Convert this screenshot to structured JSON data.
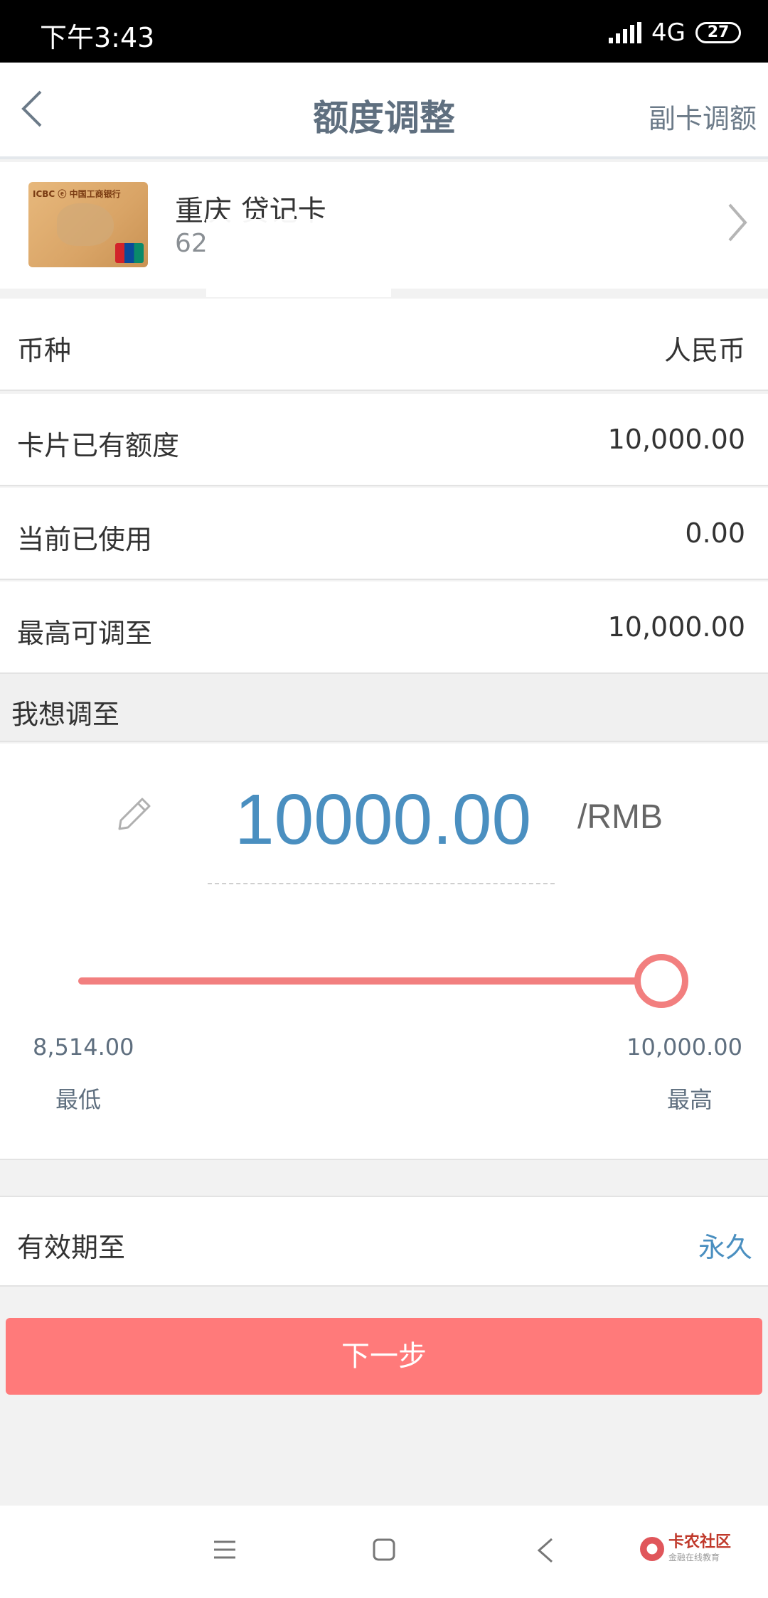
{
  "status_bar": {
    "time": "下午3:43",
    "network": "4G",
    "battery": "27"
  },
  "nav": {
    "title": "额度调整",
    "right_action": "副卡调额"
  },
  "card": {
    "name": "重庆 贷记卡",
    "number": "62"
  },
  "rows": {
    "currency": {
      "label": "币种",
      "value": "人民币"
    },
    "existing_limit": {
      "label": "卡片已有额度",
      "value": "10,000.00"
    },
    "used": {
      "label": "当前已使用",
      "value": "0.00"
    },
    "max_adjust": {
      "label": "最高可调至",
      "value": "10,000.00"
    }
  },
  "adjust": {
    "header": "我想调至",
    "amount": "10000.00",
    "unit": "/RMB",
    "slider_fraction": 1.0,
    "min_value": "8,514.00",
    "min_label": "最低",
    "max_value": "10,000.00",
    "max_label": "最高"
  },
  "validity": {
    "label": "有效期至",
    "value": "永久"
  },
  "actions": {
    "next": "下一步"
  },
  "watermark": {
    "name": "卡农社区",
    "sub": "金融在线教育"
  },
  "colors": {
    "accent_blue": "#4a8fc0",
    "accent_red": "#ff7a7a"
  }
}
